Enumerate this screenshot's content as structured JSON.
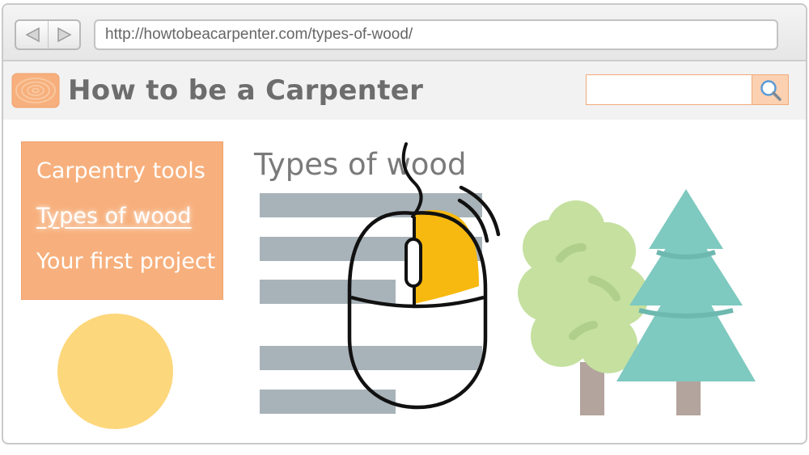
{
  "browser": {
    "url": "http://howtobeacarpenter.com/types-of-wood/",
    "back_icon": "triangle-left-icon",
    "forward_icon": "triangle-right-icon"
  },
  "site": {
    "title": "How to be a Carpenter",
    "logo_icon": "wood-rings-icon",
    "search": {
      "value": "",
      "placeholder": "",
      "button_icon": "magnifier-icon"
    }
  },
  "sidebar": {
    "items": [
      {
        "label": "Carpentry tools",
        "active": false
      },
      {
        "label": "Types of wood",
        "active": true
      },
      {
        "label": "Your first project",
        "active": false
      }
    ]
  },
  "main": {
    "heading": "Types of wood"
  },
  "illustrations": {
    "mouse_icon": "computer-mouse-right-click-icon",
    "trees": [
      "deciduous-tree-icon",
      "pine-tree-icon"
    ]
  },
  "colors": {
    "accent_orange": "#f7b07d",
    "search_border": "#f2a97a",
    "mouse_button": "#f7b90f",
    "pine": "#7ec9c0",
    "leafy": "#c5e09f",
    "trunk": "#b3a49d",
    "placeholder_lines": "#a8b3b9",
    "circle": "#fdd77c"
  }
}
